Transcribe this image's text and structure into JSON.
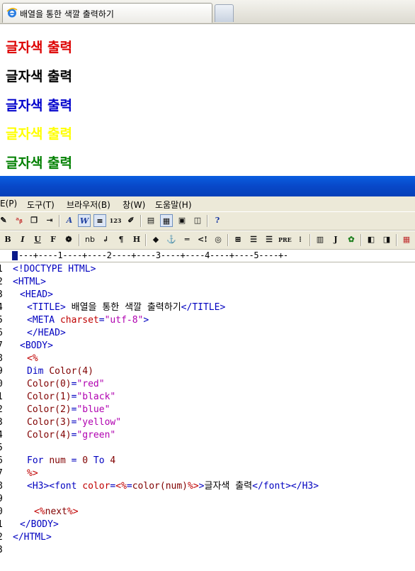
{
  "browser": {
    "tab_title": "배열을 통한 색깔 출력하기"
  },
  "rendered_page": {
    "headings": [
      {
        "text": "글자색 출력",
        "color": "#dd0000"
      },
      {
        "text": "글자색 출력",
        "color": "#000000"
      },
      {
        "text": "글자색 출력",
        "color": "#0000cc"
      },
      {
        "text": "글자색 출력",
        "color": "#ffff00"
      },
      {
        "text": "글자색 출력",
        "color": "#008000"
      }
    ]
  },
  "editor": {
    "menu": [
      "E(P)",
      "도구(T)",
      "브라우저(B)",
      "창(W)",
      "도움말(H)"
    ],
    "toolbar2_labels": [
      "B",
      "I",
      "U",
      "F",
      "nb",
      "H",
      "PRE",
      "J"
    ],
    "ruler": "---+----1----+----2----+----3----+----4----+----5----+-",
    "lines": [
      {
        "n": "1",
        "parts": [
          [
            "tag",
            "<!DOCTYPE HTML>"
          ]
        ]
      },
      {
        "n": "2",
        "parts": [
          [
            "tag",
            "<HTML>"
          ]
        ]
      },
      {
        "n": "3",
        "parts": [
          [
            "tag",
            "<HEAD>"
          ]
        ]
      },
      {
        "n": "4",
        "parts": [
          [
            "tag",
            "<TITLE>"
          ],
          [
            "plain",
            " 배열을 통한 색깔 출력하기"
          ],
          [
            "tag",
            "</TITLE>"
          ]
        ]
      },
      {
        "n": "5",
        "parts": [
          [
            "tag",
            "<META "
          ],
          [
            "attr",
            "charset"
          ],
          [
            "tag",
            "="
          ],
          [
            "str",
            "\"utf-8\""
          ],
          [
            "tag",
            ">"
          ]
        ]
      },
      {
        "n": "6",
        "parts": [
          [
            "tag",
            "</HEAD>"
          ]
        ]
      },
      {
        "n": "7",
        "parts": [
          [
            "tag",
            "<BODY>"
          ]
        ]
      },
      {
        "n": "8",
        "parts": [
          [
            "attr",
            "<%"
          ]
        ]
      },
      {
        "n": "9",
        "parts": [
          [
            "kw",
            "Dim "
          ],
          [
            "var",
            "Color(4)"
          ]
        ]
      },
      {
        "n": "0",
        "parts": [
          [
            "var",
            "Color(0)"
          ],
          [
            "kw",
            "="
          ],
          [
            "str",
            "\"red\""
          ]
        ]
      },
      {
        "n": "1",
        "parts": [
          [
            "var",
            "Color(1)"
          ],
          [
            "kw",
            "="
          ],
          [
            "str",
            "\"black\""
          ]
        ]
      },
      {
        "n": "2",
        "parts": [
          [
            "var",
            "Color(2)"
          ],
          [
            "kw",
            "="
          ],
          [
            "str",
            "\"blue\""
          ]
        ]
      },
      {
        "n": "3",
        "parts": [
          [
            "var",
            "Color(3)"
          ],
          [
            "kw",
            "="
          ],
          [
            "str",
            "\"yellow\""
          ]
        ]
      },
      {
        "n": "4",
        "parts": [
          [
            "var",
            "Color(4)"
          ],
          [
            "kw",
            "="
          ],
          [
            "str",
            "\"green\""
          ]
        ]
      },
      {
        "n": "5",
        "parts": []
      },
      {
        "n": "6",
        "parts": [
          [
            "kw",
            "For "
          ],
          [
            "var",
            "num"
          ],
          [
            "kw",
            " = "
          ],
          [
            "var",
            "0"
          ],
          [
            "kw",
            " To "
          ],
          [
            "var",
            "4"
          ]
        ]
      },
      {
        "n": "7",
        "parts": [
          [
            "attr",
            "%>"
          ]
        ]
      },
      {
        "n": "8",
        "parts": [
          [
            "tag",
            "<H3><font "
          ],
          [
            "attr",
            "color"
          ],
          [
            "tag",
            "="
          ],
          [
            "attr",
            "<%"
          ],
          [
            "kw",
            "="
          ],
          [
            "var",
            "color(num)"
          ],
          [
            "attr",
            "%>"
          ],
          [
            "tag",
            ">"
          ],
          [
            "plain",
            "글자색 출력"
          ],
          [
            "tag",
            "</font></H3>"
          ]
        ]
      },
      {
        "n": "9",
        "parts": []
      },
      {
        "n": "0",
        "parts": [
          [
            "attr",
            "<%"
          ],
          [
            "var",
            "next"
          ],
          [
            "attr",
            "%>"
          ]
        ]
      },
      {
        "n": "1",
        "parts": [
          [
            "tag",
            "</BODY>"
          ]
        ]
      },
      {
        "n": "2",
        "parts": [
          [
            "tag",
            "</HTML>"
          ]
        ]
      },
      {
        "n": "3",
        "parts": []
      }
    ]
  }
}
